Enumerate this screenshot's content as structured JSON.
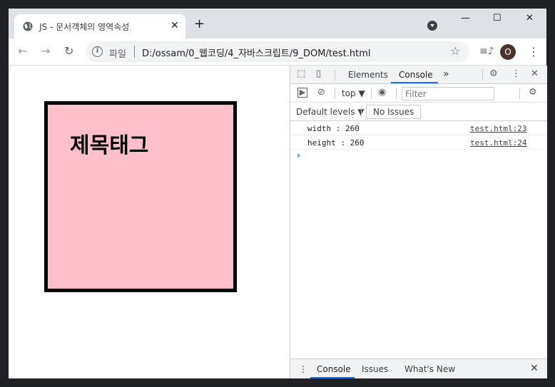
{
  "browser": {
    "tab_title": "JS - 문서객체의 영역속성",
    "tab_close": "✕",
    "new_tab": "+",
    "window_controls": {
      "minimize": "—",
      "maximize": "☐",
      "close": "✕"
    },
    "nav": {
      "back": "←",
      "forward": "→",
      "reload": "↻"
    },
    "omnibox": {
      "info": "i",
      "scheme_label": "파일",
      "url": "D:/ossam/0_웹코딩/4_자바스크립트/9_DOM/test.html",
      "star": "☆"
    },
    "media": "≡♪",
    "profile_initial": "O",
    "menu": "⋮"
  },
  "page": {
    "heading": "제목태그",
    "box_color": "#ffc0cb",
    "box_border": "#000000"
  },
  "devtools": {
    "tabs": {
      "elements": "Elements",
      "console": "Console",
      "more": "»"
    },
    "icons": {
      "inspect": "⬚",
      "device": "▯",
      "settings": "⚙",
      "menu": "⋮",
      "close": "✕"
    },
    "toolbar": {
      "sidebar": "▶",
      "clear": "⊘",
      "context": "top ▼",
      "eye": "◉",
      "filter_placeholder": "Filter",
      "settings": "⚙",
      "levels": "Default levels ▼",
      "issues": "No Issues"
    },
    "console_logs": [
      {
        "message": "width : 260",
        "source": "test.html:23"
      },
      {
        "message": "height : 260",
        "source": "test.html:24"
      }
    ],
    "prompt": "›",
    "drawer": {
      "menu": "⋮",
      "console": "Console",
      "issues": "Issues",
      "whats_new": "What's New",
      "close": "✕"
    },
    "accent_color": "#1a73e8"
  }
}
